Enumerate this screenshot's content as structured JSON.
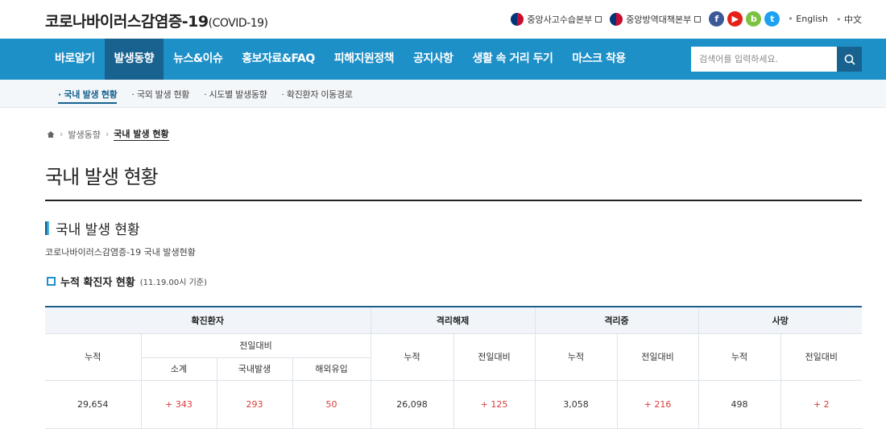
{
  "header": {
    "site_title": "코로나바이러스감염증-19",
    "site_title_suffix": "(COVID-19)",
    "links": [
      {
        "label": "중앙사고수습본부"
      },
      {
        "label": "중앙방역대책본부"
      }
    ],
    "sns": [
      {
        "icon": "facebook-icon",
        "glyph": "f",
        "color": "#3b5998"
      },
      {
        "icon": "youtube-icon",
        "glyph": "▶",
        "color": "#e62117"
      },
      {
        "icon": "naver-blog-icon",
        "glyph": "b",
        "color": "#7cc242"
      },
      {
        "icon": "twitter-icon",
        "glyph": "t",
        "color": "#1da1f2"
      }
    ],
    "lang": [
      "English",
      "中文"
    ]
  },
  "nav": {
    "items": [
      "바로알기",
      "발생동향",
      "뉴스&이슈",
      "홍보자료&FAQ",
      "피해지원정책",
      "공지사항",
      "생활 속 거리 두기",
      "마스크 착용"
    ],
    "active": 1,
    "search_placeholder": "검색어를 입력하세요."
  },
  "subnav": {
    "items": [
      "국내 발생 현황",
      "국외 발생 현황",
      "시도별 발생동향",
      "확진환자 이동경로"
    ],
    "active": 0
  },
  "breadcrumb": {
    "parent": "발생동향",
    "current": "국내 발생 현황"
  },
  "page_title": "국내 발생 현황",
  "section": {
    "title": "국내 발생 현황",
    "description": "코로나바이러스감염증-19 국내 발생현황",
    "subtitle": "누적 확진자 현황",
    "subtitle_note": "(11.19.00시 기준)"
  },
  "table": {
    "groups": [
      "확진환자",
      "격리해제",
      "격리중",
      "사망"
    ],
    "cumulative": "누적",
    "daily_change": "전일대비",
    "breakdown": [
      "소계",
      "국내발생",
      "해외유입"
    ],
    "confirmed": {
      "total": "29,654",
      "subtotal": "+ 343",
      "domestic": "293",
      "imported": "50"
    },
    "released": {
      "total": "26,098",
      "change": "+ 125"
    },
    "isolated": {
      "total": "3,058",
      "change": "+ 216"
    },
    "deaths": {
      "total": "498",
      "change": "+ 2"
    }
  }
}
